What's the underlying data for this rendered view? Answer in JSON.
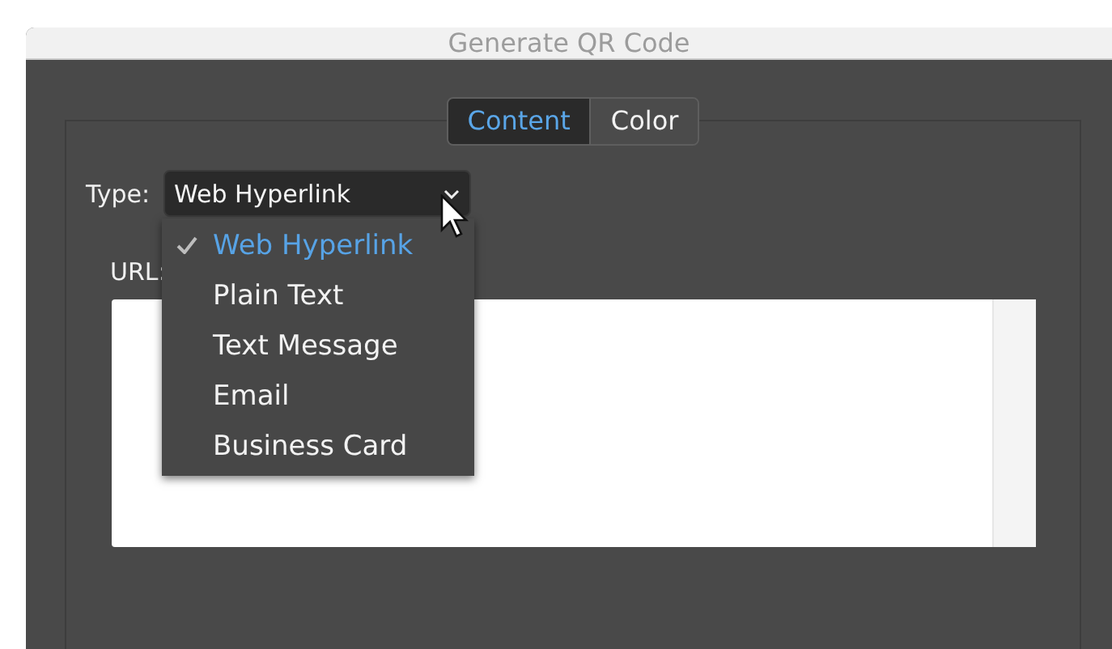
{
  "window": {
    "title": "Generate QR Code"
  },
  "tabs": [
    {
      "label": "Content",
      "selected": true
    },
    {
      "label": "Color",
      "selected": false
    }
  ],
  "type_field": {
    "label": "Type:",
    "value": "Web Hyperlink",
    "expanded": true
  },
  "type_menu": [
    {
      "label": "Web Hyperlink",
      "selected": true
    },
    {
      "label": "Plain Text",
      "selected": false
    },
    {
      "label": "Text Message",
      "selected": false
    },
    {
      "label": "Email",
      "selected": false
    },
    {
      "label": "Business Card",
      "selected": false
    }
  ],
  "url_field": {
    "label": "URL:"
  }
}
